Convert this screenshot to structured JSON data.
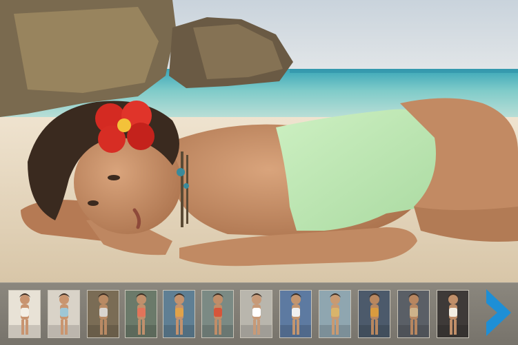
{
  "gallery": {
    "hero": {
      "icon": "beach-photo"
    },
    "thumbnails": [
      {
        "bg": "#e8e2d6",
        "suit": "#f3efe6",
        "skin": "#c89470"
      },
      {
        "bg": "#d9d3c8",
        "suit": "#9ec7d6",
        "skin": "#c9956f"
      },
      {
        "bg": "#7a6c55",
        "suit": "#d8d4cf",
        "skin": "#b98a64"
      },
      {
        "bg": "#6b7a6a",
        "suit": "#e2745a",
        "skin": "#c0906c"
      },
      {
        "bg": "#5f7f94",
        "suit": "#e0a24a",
        "skin": "#c4926d"
      },
      {
        "bg": "#7b8a84",
        "suit": "#d6553a",
        "skin": "#c08d68"
      },
      {
        "bg": "#b9b6ad",
        "suit": "#ffffff",
        "skin": "#c79a78"
      },
      {
        "bg": "#5d7aa1",
        "suit": "#f0f0f0",
        "skin": "#c3956f"
      },
      {
        "bg": "#8fa6b0",
        "suit": "#d9b46b",
        "skin": "#c89a72"
      },
      {
        "bg": "#4c5a6b",
        "suit": "#d99b3f",
        "skin": "#b8875f"
      },
      {
        "bg": "#5a5f66",
        "suit": "#cdb28a",
        "skin": "#b78660"
      },
      {
        "bg": "#3e3a38",
        "suit": "#f2ede2",
        "skin": "#c08f69"
      }
    ],
    "next_icon": "chevron-right-icon",
    "accent": "#1e8fd6"
  }
}
